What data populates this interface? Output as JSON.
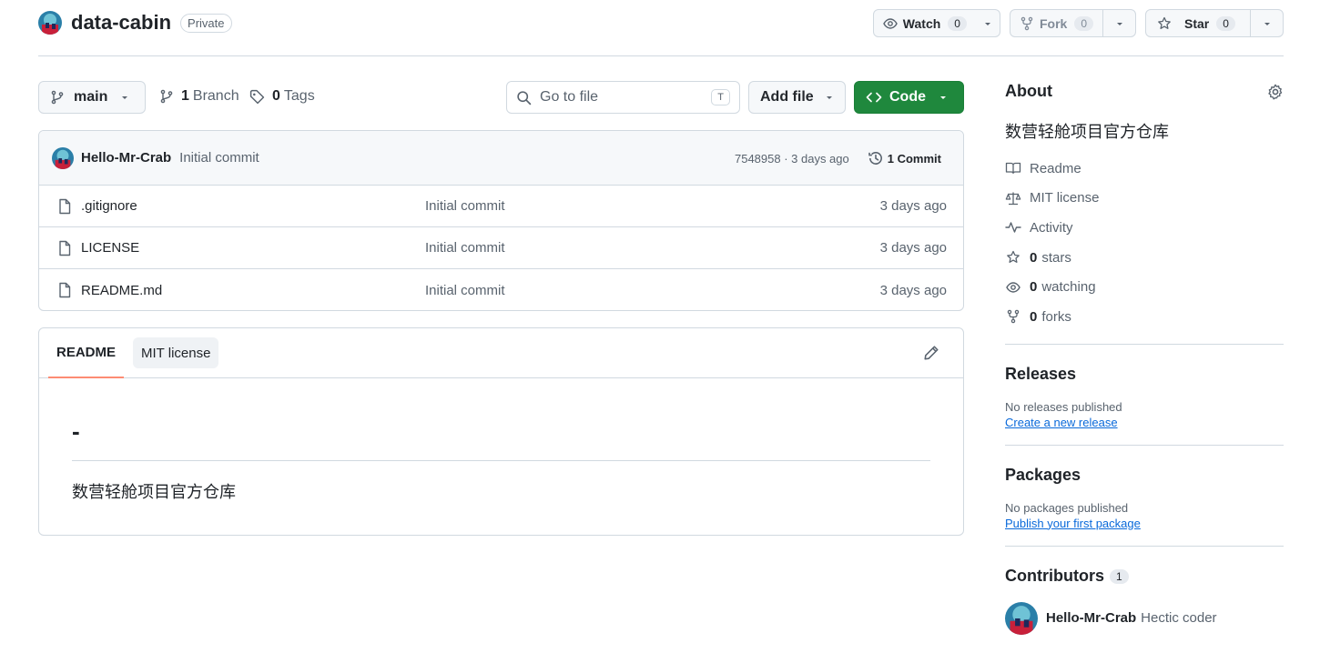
{
  "repo": {
    "name": "data-cabin",
    "visibility": "Private"
  },
  "actions": {
    "watch": {
      "label": "Watch",
      "count": "0"
    },
    "fork": {
      "label": "Fork",
      "count": "0"
    },
    "star": {
      "label": "Star",
      "count": "0"
    }
  },
  "nav": {
    "branch": "main",
    "branch_count": "1",
    "branch_label": "Branch",
    "tag_count": "0",
    "tag_label": "Tags",
    "search_placeholder": "Go to file",
    "search_shortcut": "T",
    "add_file": "Add file",
    "code": "Code"
  },
  "commit": {
    "author": "Hello-Mr-Crab",
    "message": "Initial commit",
    "sha_time": "7548958 · 3 days ago",
    "count_label": "1 Commit"
  },
  "files": [
    {
      "name": ".gitignore",
      "commit": "Initial commit",
      "date": "3 days ago"
    },
    {
      "name": "LICENSE",
      "commit": "Initial commit",
      "date": "3 days ago"
    },
    {
      "name": "README.md",
      "commit": "Initial commit",
      "date": "3 days ago"
    }
  ],
  "readme": {
    "tabs": [
      "README",
      "MIT license"
    ],
    "heading": "-",
    "paragraph": "数营轻舱项目官方仓库"
  },
  "about": {
    "title": "About",
    "description": "数营轻舱项目官方仓库",
    "readme": "Readme",
    "license": "MIT license",
    "activity": "Activity",
    "stars_count": "0",
    "stars_label": "stars",
    "watching_count": "0",
    "watching_label": "watching",
    "forks_count": "0",
    "forks_label": "forks"
  },
  "releases": {
    "title": "Releases",
    "text": "No releases published",
    "link": "Create a new release"
  },
  "packages": {
    "title": "Packages",
    "text": "No packages published",
    "link": "Publish your first package"
  },
  "contributors": {
    "title": "Contributors",
    "count": "1",
    "name": "Hello-Mr-Crab",
    "subtitle": "Hectic coder"
  },
  "colors": {
    "accent_green": "#1f883d",
    "link_blue": "#0969da",
    "tab_underline": "#fd8c73",
    "border": "#d1d9e0"
  }
}
